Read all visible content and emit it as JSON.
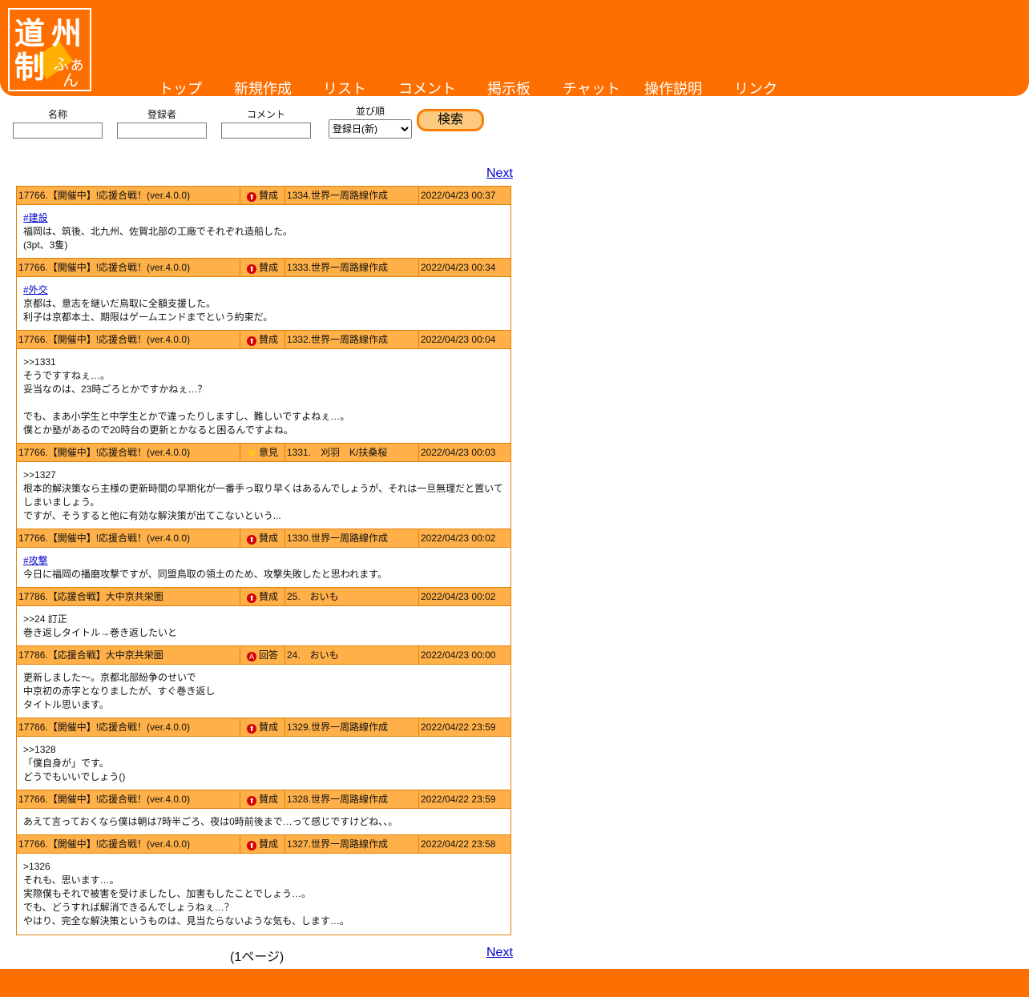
{
  "logo": {
    "char1": "道",
    "char2": "州",
    "char3": "制",
    "small1": "ふぁ",
    "small2": "ん"
  },
  "nav": [
    {
      "label": "トップ"
    },
    {
      "label": "新規作成"
    },
    {
      "label": "リスト"
    },
    {
      "label": "コメント"
    },
    {
      "label": "掲示板"
    },
    {
      "label": "チャット"
    },
    {
      "label": "操作説明"
    },
    {
      "label": "リンク"
    }
  ],
  "search": {
    "name_label": "名称",
    "registrant_label": "登録者",
    "comment_label": "コメント",
    "order_label": "並び順",
    "order_selected": "登録日(新)",
    "button": "検索"
  },
  "pager": {
    "next": "Next",
    "pageinfo": "(1ページ)"
  },
  "colors": {
    "header": "#ff6f00",
    "row": "#ffb048",
    "border": "#e5800a"
  },
  "posts": [
    {
      "title": "17766.【開催中】!応援合戦！(ver.4.0.0)",
      "type": "賛成",
      "icon": "up",
      "author": "1334.世界一周路線作成",
      "date": "2022/04/23 00:37",
      "tag": "#建設",
      "lines": [
        "福岡は、筑後、北九州、佐賀北部の工廠でそれぞれ造船した。",
        "(3pt、3隻)"
      ]
    },
    {
      "title": "17766.【開催中】!応援合戦！(ver.4.0.0)",
      "type": "賛成",
      "icon": "up",
      "author": "1333.世界一周路線作成",
      "date": "2022/04/23 00:34",
      "tag": "#外交",
      "lines": [
        "京都は、意志を継いだ鳥取に全額支援した。",
        "利子は京都本土、期限はゲームエンドまでという約束だ。"
      ]
    },
    {
      "title": "17766.【開催中】!応援合戦！(ver.4.0.0)",
      "type": "賛成",
      "icon": "up",
      "author": "1332.世界一周路線作成",
      "date": "2022/04/23 00:04",
      "tag": "",
      "lines": [
        ">>1331",
        "そうですすねぇ…。",
        "妥当なのは、23時ごろとかですかねぇ…？",
        "",
        "でも、まあ小学生と中学生とかで違ったりしますし、難しいですよねぇ…。",
        "僕とか塾があるので20時台の更新とかなると困るんですよね。"
      ]
    },
    {
      "title": "17766.【開催中】!応援合戦！(ver.4.0.0)",
      "type": "意見",
      "icon": "star",
      "author": "1331.　刈羽　K/扶桑桜",
      "date": "2022/04/23 00:03",
      "tag": "",
      "lines": [
        ">>1327",
        "根本的解決策なら主様の更新時間の早期化が一番手っ取り早くはあるんでしょうが、それは一旦無理だと置いて",
        "しまいましょう。",
        "ですが、そうすると他に有効な解決策が出てこないという..."
      ]
    },
    {
      "title": "17766.【開催中】!応援合戦！(ver.4.0.0)",
      "type": "賛成",
      "icon": "up",
      "author": "1330.世界一周路線作成",
      "date": "2022/04/23 00:02",
      "tag": "#攻撃",
      "lines": [
        "今日に福岡の播磨攻撃ですが、同盟鳥取の領土のため、攻撃失敗したと思われます。"
      ]
    },
    {
      "title": "17786.【応援合戦】大中京共栄圏",
      "type": "賛成",
      "icon": "up",
      "author": "25.　おいも",
      "date": "2022/04/23 00:02",
      "tag": "",
      "lines": [
        ">>24 訂正",
        "巻き返しタイトル→巻き返したいと"
      ]
    },
    {
      "title": "17786.【応援合戦】大中京共栄圏",
      "type": "回答",
      "icon": "ans",
      "author": "24.　おいも",
      "date": "2022/04/23 00:00",
      "tag": "",
      "lines": [
        "更新しました〜。京都北部紛争のせいで",
        "中京初の赤字となりましたが、すぐ巻き返し",
        "タイトル思います。"
      ]
    },
    {
      "title": "17766.【開催中】!応援合戦！(ver.4.0.0)",
      "type": "賛成",
      "icon": "up",
      "author": "1329.世界一周路線作成",
      "date": "2022/04/22 23:59",
      "tag": "",
      "lines": [
        ">>1328",
        "「僕自身が」です。",
        "どうでもいいでしょう()"
      ]
    },
    {
      "title": "17766.【開催中】!応援合戦！(ver.4.0.0)",
      "type": "賛成",
      "icon": "up",
      "author": "1328.世界一周路線作成",
      "date": "2022/04/22 23:59",
      "tag": "",
      "lines": [
        "あえて言っておくなら僕は朝は7時半ごろ、夜は0時前後まで…って感じですけどね、、。"
      ]
    },
    {
      "title": "17766.【開催中】!応援合戦！(ver.4.0.0)",
      "type": "賛成",
      "icon": "up",
      "author": "1327.世界一周路線作成",
      "date": "2022/04/22 23:58",
      "tag": "",
      "lines": [
        ">1326",
        "それも、思います…。",
        "実際僕もそれで被害を受けましたし、加害もしたことでしょう…。",
        "でも、どうすれば解消できるんでしょうねぇ…？",
        "やはり、完全な解決策というものは、見当たらないような気も、します…。"
      ]
    }
  ]
}
